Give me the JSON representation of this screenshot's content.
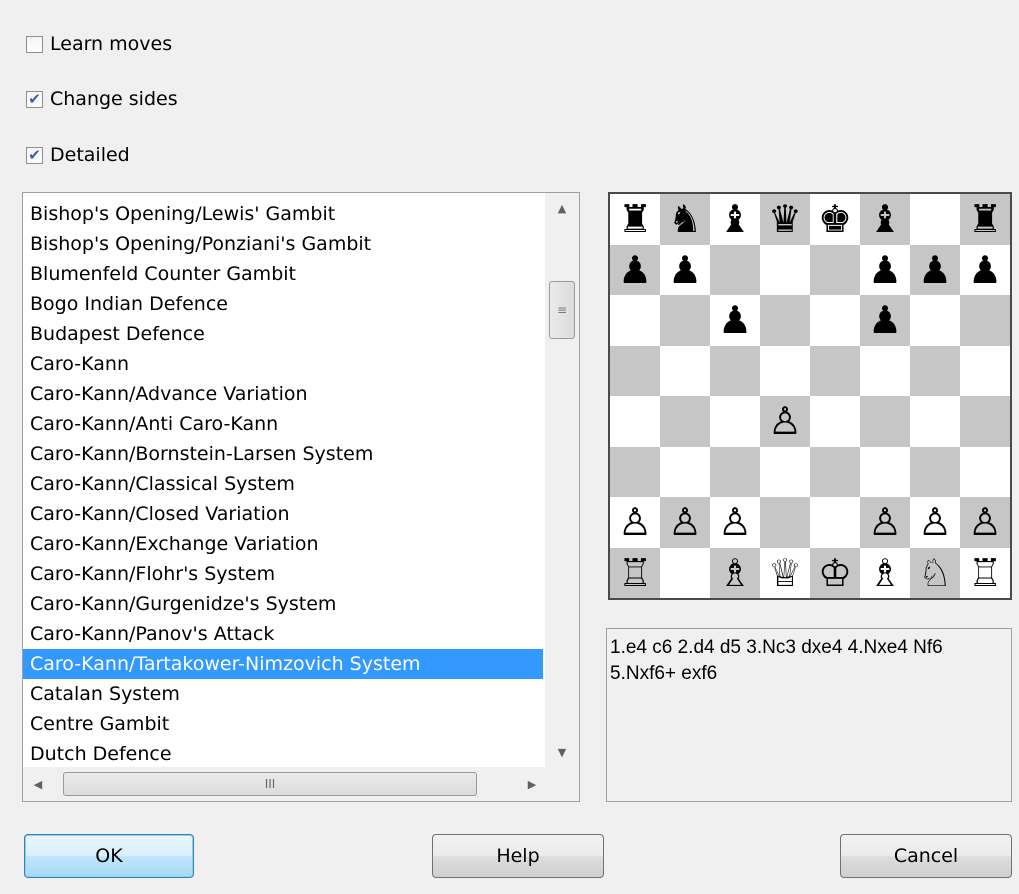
{
  "options": [
    {
      "label": "Learn moves",
      "checked": false
    },
    {
      "label": "Change sides",
      "checked": true
    },
    {
      "label": "Detailed",
      "checked": true
    }
  ],
  "openings": [
    "Bishop's Opening/Lewis' Gambit",
    "Bishop's Opening/Ponziani's Gambit",
    "Blumenfeld Counter Gambit",
    "Bogo Indian Defence",
    "Budapest Defence",
    "Caro-Kann",
    "Caro-Kann/Advance Variation",
    "Caro-Kann/Anti Caro-Kann",
    "Caro-Kann/Bornstein-Larsen System",
    "Caro-Kann/Classical System",
    "Caro-Kann/Closed Variation",
    "Caro-Kann/Exchange Variation",
    "Caro-Kann/Flohr's System",
    "Caro-Kann/Gurgenidze's System",
    "Caro-Kann/Panov's Attack",
    "Caro-Kann/Tartakower-Nimzovich System",
    "Catalan System",
    "Centre Gambit",
    "Dutch Defence"
  ],
  "selected_index": 15,
  "board": {
    "ranks": [
      [
        "♜",
        "♞",
        "♝",
        "♛",
        "♚",
        "♝",
        "",
        "♜"
      ],
      [
        "♟",
        "♟",
        "",
        "",
        "",
        "♟",
        "♟",
        "♟"
      ],
      [
        "",
        "",
        "♟",
        "",
        "",
        "♟",
        "",
        ""
      ],
      [
        "",
        "",
        "",
        "",
        "",
        "",
        "",
        ""
      ],
      [
        "",
        "",
        "",
        "♙",
        "",
        "",
        "",
        ""
      ],
      [
        "",
        "",
        "",
        "",
        "",
        "",
        "",
        ""
      ],
      [
        "♙",
        "♙",
        "♙",
        "",
        "",
        "♙",
        "♙",
        "♙"
      ],
      [
        "♖",
        "",
        "♗",
        "♕",
        "♔",
        "♗",
        "♘",
        "♖"
      ]
    ]
  },
  "moves_text": "1.e4 c6 2.d4 d5 3.Nc3 dxe4 4.Nxe4 Nf6 5.Nxf6+ exf6",
  "buttons": {
    "ok": "OK",
    "help": "Help",
    "cancel": "Cancel"
  },
  "scroll_glyphs": {
    "up": "▲",
    "down": "▼",
    "left": "◀",
    "right": "▶",
    "vgrip": "≡",
    "hgrip": "III"
  }
}
